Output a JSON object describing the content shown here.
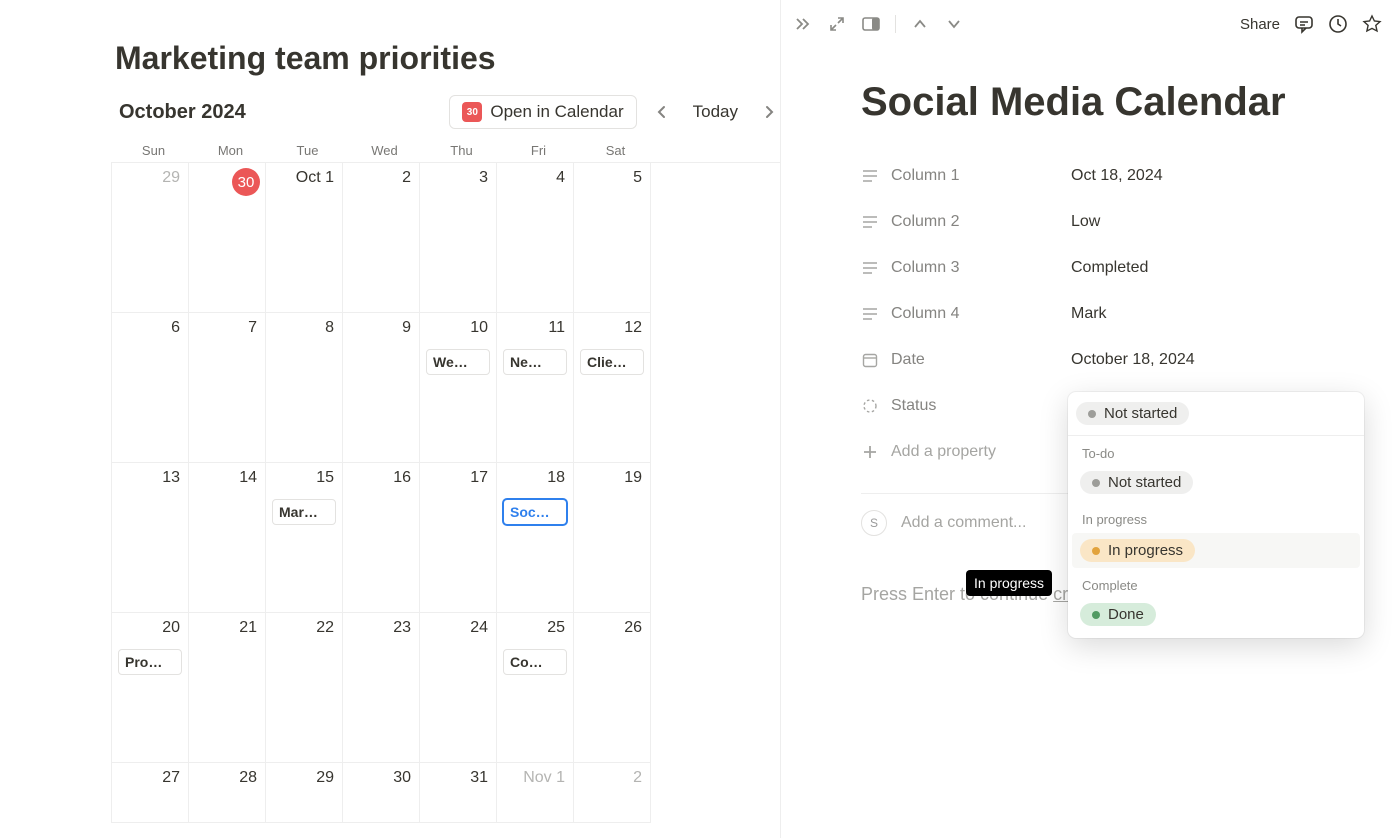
{
  "page_title": "Marketing team priorities",
  "calendar": {
    "month_label": "October 2024",
    "open_in_calendar": "Open in Calendar",
    "calendar_icon_day": "30",
    "today_label": "Today",
    "weekdays": [
      "Sun",
      "Mon",
      "Tue",
      "Wed",
      "Thu",
      "Fri",
      "Sat"
    ],
    "today_date": "30",
    "cells": [
      {
        "num": "29",
        "muted": true
      },
      {
        "num": "30",
        "today": true
      },
      {
        "num": "Oct 1",
        "month_start": true
      },
      {
        "num": "2"
      },
      {
        "num": "3"
      },
      {
        "num": "4"
      },
      {
        "num": "5"
      },
      {
        "num": "6"
      },
      {
        "num": "7"
      },
      {
        "num": "8"
      },
      {
        "num": "9"
      },
      {
        "num": "10",
        "event": "We…"
      },
      {
        "num": "11",
        "event": "Ne…"
      },
      {
        "num": "12",
        "event": "Clie…"
      },
      {
        "num": "13"
      },
      {
        "num": "14"
      },
      {
        "num": "15",
        "event": "Mar…"
      },
      {
        "num": "16"
      },
      {
        "num": "17"
      },
      {
        "num": "18",
        "event": "Soc…",
        "selected": true
      },
      {
        "num": "19"
      },
      {
        "num": "20",
        "event": "Pro…"
      },
      {
        "num": "21"
      },
      {
        "num": "22"
      },
      {
        "num": "23"
      },
      {
        "num": "24"
      },
      {
        "num": "25",
        "event": "Co…"
      },
      {
        "num": "26"
      },
      {
        "num": "27"
      },
      {
        "num": "28"
      },
      {
        "num": "29"
      },
      {
        "num": "30"
      },
      {
        "num": "31"
      },
      {
        "num": "Nov 1",
        "muted": true,
        "month_start": true
      },
      {
        "num": "2",
        "muted": true
      }
    ]
  },
  "toolbar": {
    "share": "Share"
  },
  "detail": {
    "title": "Social Media Calendar",
    "properties": [
      {
        "icon": "text",
        "label": "Column 1",
        "value": "Oct 18, 2024"
      },
      {
        "icon": "text",
        "label": "Column 2",
        "value": "Low"
      },
      {
        "icon": "text",
        "label": "Column 3",
        "value": "Completed"
      },
      {
        "icon": "text",
        "label": "Column 4",
        "value": "Mark"
      },
      {
        "icon": "date",
        "label": "Date",
        "value": "October 18, 2024"
      },
      {
        "icon": "status",
        "label": "Status",
        "value": ""
      }
    ],
    "add_property": "Add a property",
    "comment_placeholder": "Add a comment...",
    "avatar_initial": "S",
    "hint_continue": "Press Enter to continue",
    "hint_create_template": "create a template"
  },
  "status_popover": {
    "selected": {
      "dot": "grey",
      "label": "Not started",
      "bg": "default"
    },
    "groups": [
      {
        "label": "To-do",
        "options": [
          {
            "dot": "grey",
            "label": "Not started",
            "bg": "default"
          }
        ]
      },
      {
        "label": "In progress",
        "options": [
          {
            "dot": "orange",
            "label": "In progress",
            "bg": "orange",
            "hovered": true
          }
        ]
      },
      {
        "label": "Complete",
        "options": [
          {
            "dot": "green",
            "label": "Done",
            "bg": "green"
          }
        ]
      }
    ]
  },
  "tooltip": "In progress"
}
